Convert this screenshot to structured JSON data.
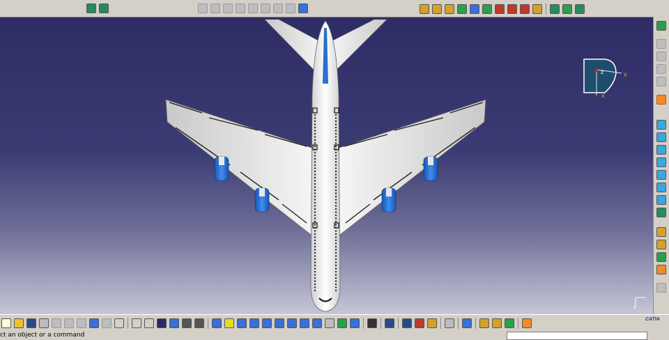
{
  "viewport": {
    "background_top": "#2e2c64",
    "background_bottom": "#c6c6d8"
  },
  "compass": {
    "x_label": "x",
    "y_label": "y",
    "z_label": "z"
  },
  "axis_tripod": {
    "x_label": "x"
  },
  "status": {
    "message": "ct an object or a command"
  },
  "branding": {
    "logo_text": "CATIA"
  },
  "colors": {
    "aircraft_body": "#f2f2f2",
    "engine": "#1f6fd6",
    "tail_stripe": "#2a6fcf",
    "compass_face": "#1e4e6e"
  },
  "top_toolbar": {
    "icons": [
      "view-select-icon",
      "view-fit-icon",
      "pan-icon",
      "rotate-icon",
      "zoom-icon",
      "normal-view-icon",
      "hide-show-icon",
      "swap-icon",
      "quick-view-icon",
      "render-icon",
      "analysis-icon",
      "measure-icon",
      "apply-material-icon",
      "catalog-icon",
      "compass-icon",
      "product-icon",
      "tools-icon"
    ]
  },
  "bottom_toolbar": {
    "icons": [
      "new-icon",
      "open-icon",
      "save-icon",
      "print-icon",
      "cut-icon",
      "copy-icon",
      "paste-icon",
      "undo-icon",
      "redo-icon",
      "help-icon",
      "formula-icon",
      "comment-icon",
      "table-icon",
      "tree-icon",
      "hide-icon",
      "swap-visible-icon",
      "fly-icon",
      "fit-all-icon",
      "pan-icon",
      "rotate-icon",
      "zoom-in-icon",
      "zoom-out-icon",
      "normal-view-icon",
      "multi-view-icon",
      "iso-view-icon",
      "shading-icon",
      "hide-show-icon",
      "camera-icon",
      "measure-icon",
      "distance-icon",
      "inertia-icon",
      "sketch-icon",
      "update-icon",
      "material-icon",
      "render-icon",
      "catalog-icon"
    ]
  },
  "right_toolbar": {
    "icons": [
      "spec-tree-icon",
      "pad-icon",
      "pocket-icon",
      "shaft-icon",
      "groove-icon",
      "select-arrow-icon",
      "cube-icon",
      "cube-icon",
      "cube-icon",
      "cube-icon",
      "cube-icon",
      "cube-icon",
      "cube-icon",
      "face-icon",
      "constraint-icon",
      "constraint-icon",
      "move-icon",
      "spark-icon",
      "tool-icon"
    ]
  }
}
